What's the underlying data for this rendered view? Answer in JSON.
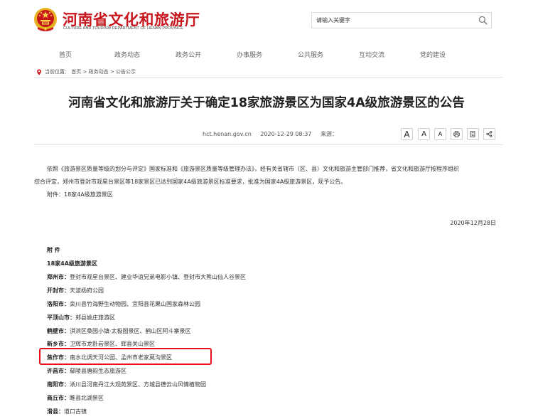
{
  "header": {
    "site_title": "河南省文化和旅游厅",
    "site_subtitle": "CULTURE AND TOURISM DEPARTMENT OF HENAN PROVINCE",
    "search_placeholder": "请输入关键字"
  },
  "nav": [
    "首页",
    "政务动态",
    "政务公开",
    "办事服务",
    "公共服务",
    "互动交流",
    "党的建设"
  ],
  "breadcrumb": {
    "label": "当前位置：",
    "items": [
      "首页",
      "政务动态",
      "公告公示"
    ],
    "separator": ">"
  },
  "article": {
    "title": "河南省文化和旅游厅关于确定18家旅游景区为国家4A级旅游景区的公告",
    "source_site": "hct.henan.gov.cn",
    "datetime": "2020-12-29 08:37",
    "source_label": "来源：",
    "tools": [
      "A",
      "A",
      "A",
      "print-icon",
      "copy-icon",
      "share-icon"
    ],
    "paragraph_line1": "依照《旅游景区质量等级的划分与评定》国家标准和《旅游景区质量等级管理办法》，经有关省辖市（区、县）文化和旅游主管部门推荐，省文化和旅游厅按程序组织",
    "paragraph_line2": "综合评定，郑州市登封市观星台景区等18家景区已达到国家4A级旅游景区标准要求，批准为国家4A级旅游景区，现予公告。",
    "attachment": "附件：18家4A级旅游景区",
    "date": "2020年12月28日",
    "appendix_label": "附 件",
    "appendix_title": "18家4A级旅游景区",
    "scenic_list": [
      {
        "city": "郑州市：",
        "spots": "登封市观星台景区、建业华谊兄弟电影小镇、登封市大熊山仙人谷景区"
      },
      {
        "city": "开封市：",
        "spots": "天波杨府公园"
      },
      {
        "city": "洛阳市：",
        "spots": "栾川县竹海野生动物园、宜阳县花果山国家森林公园"
      },
      {
        "city": "平顶山市：",
        "spots": "郏县姚庄旅游区"
      },
      {
        "city": "鹤壁市：",
        "spots": "淇滨区桑园小镇·太极图景区、鹤山区阿斗寨景区"
      },
      {
        "city": "新乡市：",
        "spots": "卫辉市龙卧岩景区、辉县关山景区"
      },
      {
        "city": "焦作市：",
        "spots": "南水北调天河公园、孟州市老家莫沟景区"
      },
      {
        "city": "许昌市：",
        "spots": "鄢陵县唐韵生态旅游区"
      },
      {
        "city": "南阳市：",
        "spots": "淅川县河南丹江大观苑景区、方城县德云山风情植物园"
      },
      {
        "city": "商丘市：",
        "spots": "睢县北湖景区"
      },
      {
        "city": "滑县：",
        "spots": "道口古镇"
      }
    ]
  },
  "colors": {
    "brand_red": "#c8161d",
    "highlight_red": "#e8101a",
    "emblem_gold": "#e6b422"
  }
}
